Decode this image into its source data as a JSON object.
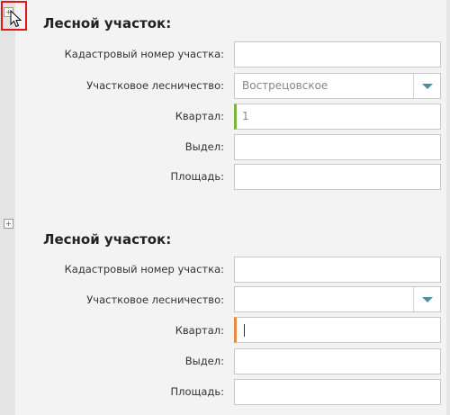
{
  "sections": [
    {
      "title": "Лесной участок:",
      "fields": {
        "cadastral": {
          "label": "Кадастровый номер участка:",
          "value": ""
        },
        "forestry": {
          "label": "Участковое лесничество:",
          "value": "Вострецовское"
        },
        "block": {
          "label": "Квартал:",
          "value": "1"
        },
        "compartment": {
          "label": "Выдел:",
          "value": ""
        },
        "area": {
          "label": "Площадь:",
          "value": ""
        }
      }
    },
    {
      "title": "Лесной участок:",
      "fields": {
        "cadastral": {
          "label": "Кадастровый номер участка:",
          "value": ""
        },
        "forestry": {
          "label": "Участковое лесничество:",
          "value": ""
        },
        "block": {
          "label": "Квартал:",
          "value": ""
        },
        "compartment": {
          "label": "Выдел:",
          "value": ""
        },
        "area": {
          "label": "Площадь:",
          "value": ""
        }
      }
    }
  ],
  "icons": {
    "expander": "plus-square-icon",
    "cursor": "mouse-pointer-icon",
    "dropdown": "triangle-down-icon"
  },
  "colors": {
    "highlight": "#e01818",
    "valid_marker": "#7cb342",
    "focus_marker": "#e8894a",
    "dropdown_arrow": "#4a8fa2"
  }
}
